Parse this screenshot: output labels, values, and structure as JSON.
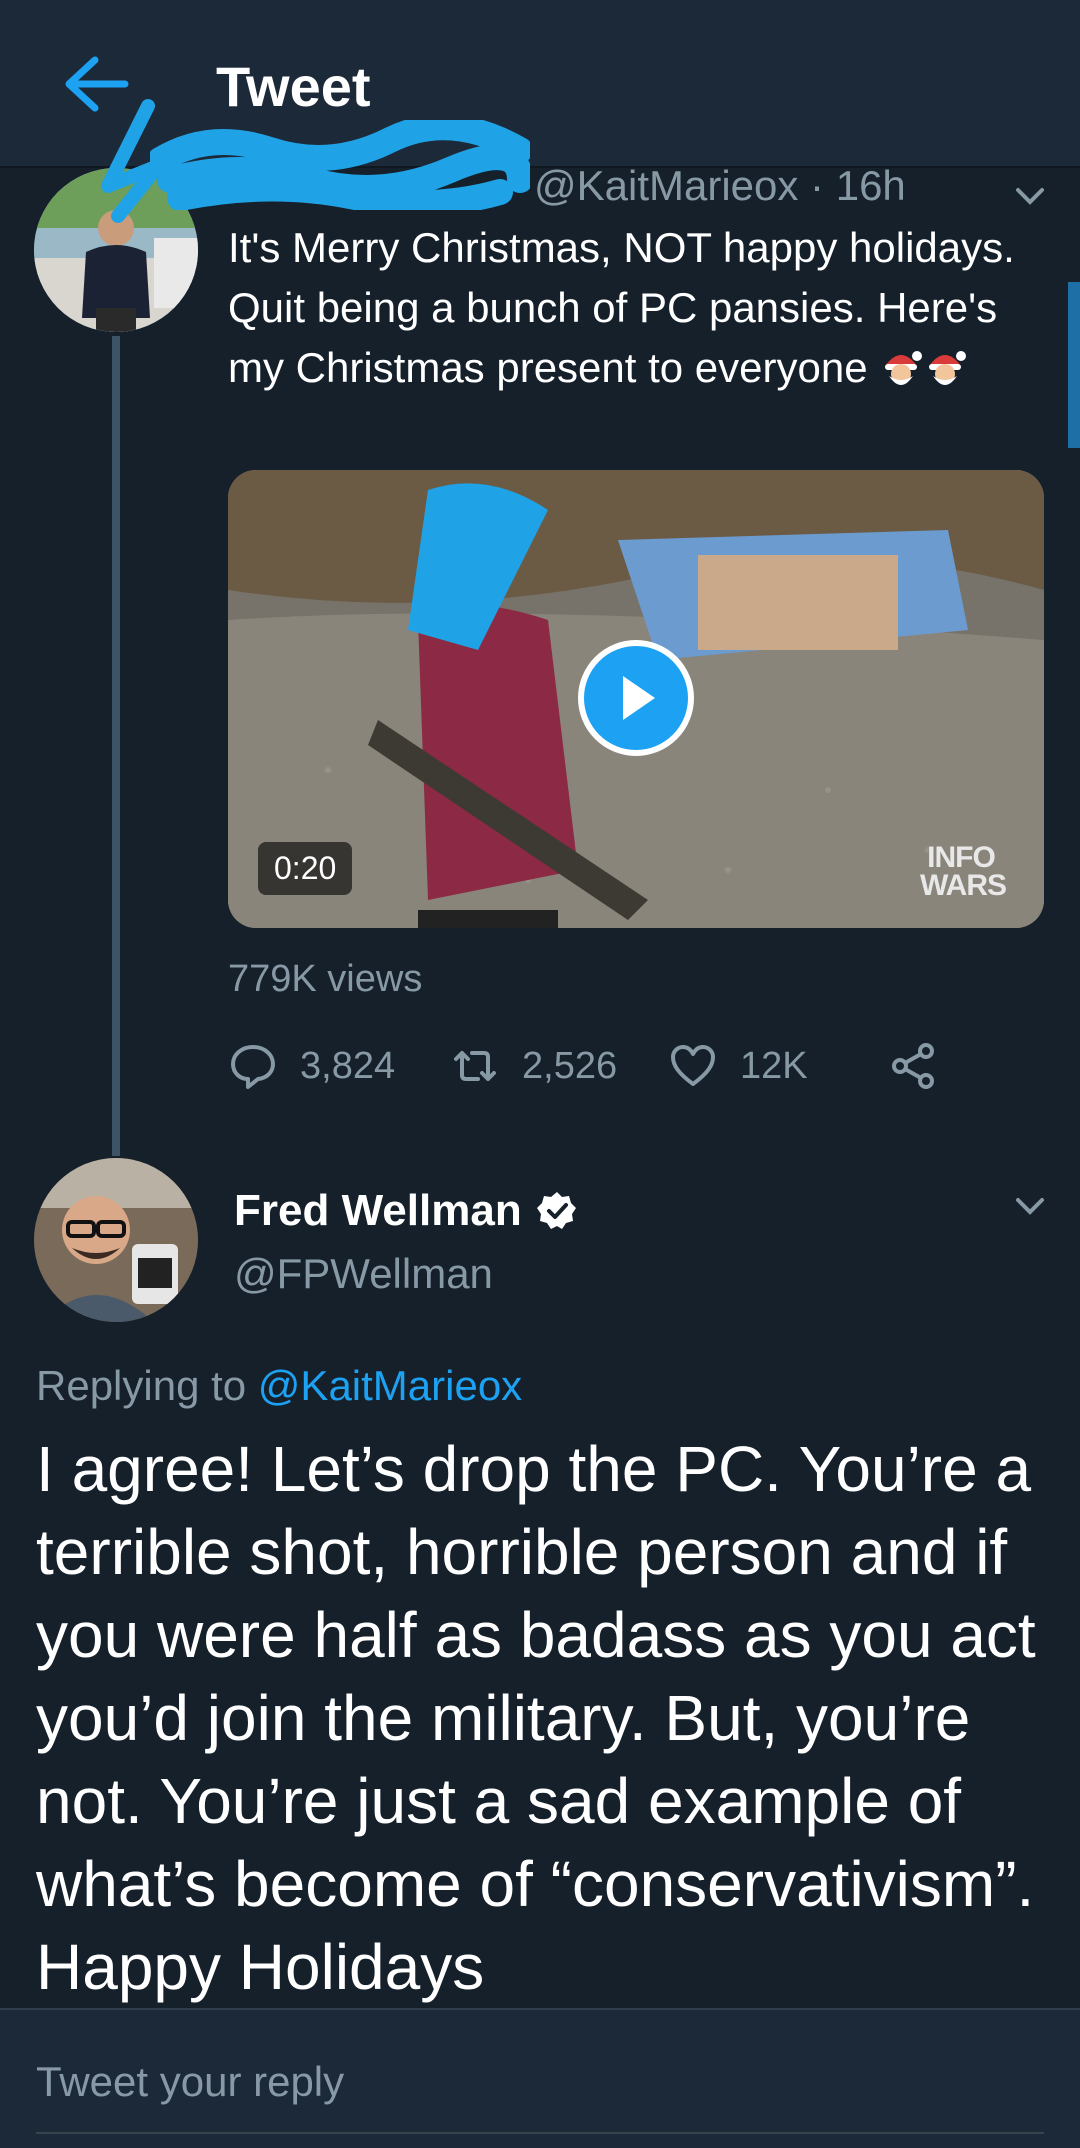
{
  "header": {
    "title": "Tweet"
  },
  "original_tweet": {
    "handle_time": "@KaitMarieox · 16h",
    "text": "It's Merry Christmas, NOT happy holidays. Quit being a bunch of PC pansies. Here's my Christmas present to everyone",
    "emojis": [
      "santa-emoji",
      "santa-emoji"
    ],
    "video": {
      "duration": "0:20",
      "watermark_line1": "INFO",
      "watermark_line2": "WARS"
    },
    "views": "779K views",
    "stats": {
      "replies": "3,824",
      "retweets": "2,526",
      "likes": "12K"
    }
  },
  "reply_tweet": {
    "name": "Fred Wellman",
    "handle": "@FPWellman",
    "replying_prefix": "Replying to",
    "replying_to": "@KaitMarieox",
    "text": "I agree! Let’s drop the PC. You’re a terrible shot, horrible person and if you were half as badass as you act you’d join the military. But, you’re not. You’re just a sad example of what’s become of “conservativism”. Happy Holidays"
  },
  "compose": {
    "placeholder": "Tweet your reply"
  },
  "colors": {
    "background": "#15202b",
    "header": "#1c2938",
    "accent": "#1da1f2",
    "secondary_text": "#8899a6"
  }
}
